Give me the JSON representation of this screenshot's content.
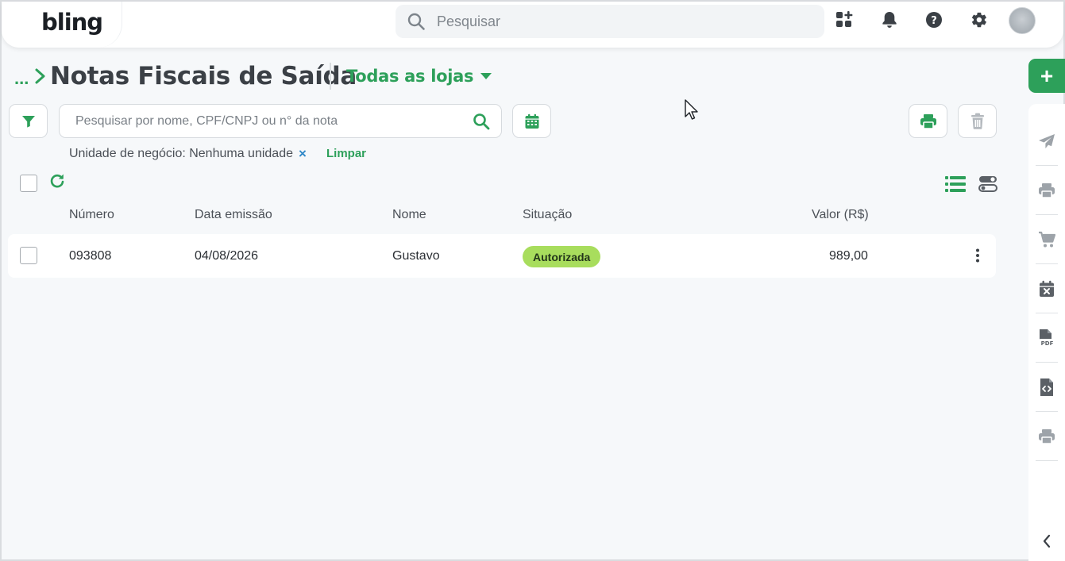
{
  "app": {
    "logo_text": "bling"
  },
  "topbar": {
    "search_placeholder": "Pesquisar",
    "icons": [
      "apps-add-icon",
      "bell-icon",
      "help-icon",
      "gear-icon"
    ],
    "avatar_name": "avatar"
  },
  "header": {
    "breadcrumb_dots": "...",
    "title": "Notas Fiscais de Saída",
    "store_selector": "Todas as lojas"
  },
  "toolbar": {
    "search_placeholder": "Pesquisar por nome, CPF/CNPJ ou n° da nota",
    "filter_chip": "Unidade de negócio: Nenhuma unidade",
    "filter_chip_remove": "×",
    "clear_label": "Limpar"
  },
  "table": {
    "columns": {
      "numero": "Número",
      "data_emissao": "Data emissão",
      "nome": "Nome",
      "situacao": "Situação",
      "valor": "Valor (R$)"
    },
    "rows": [
      {
        "numero": "093808",
        "data_emissao": "04/08/2026",
        "nome": "Gustavo",
        "situacao": "Autorizada",
        "valor": "989,00"
      }
    ]
  },
  "sidebar": {
    "add_label": "+",
    "items": [
      "send-icon",
      "print-icon",
      "cart-icon",
      "calendar-cancel-icon",
      "pdf-file-icon",
      "code-file-icon",
      "print-icon",
      "chevron-left-icon"
    ]
  },
  "colors": {
    "brand_green": "#2da05a",
    "badge_green": "#a8dd5d",
    "chip_x_blue": "#2f88c8"
  }
}
